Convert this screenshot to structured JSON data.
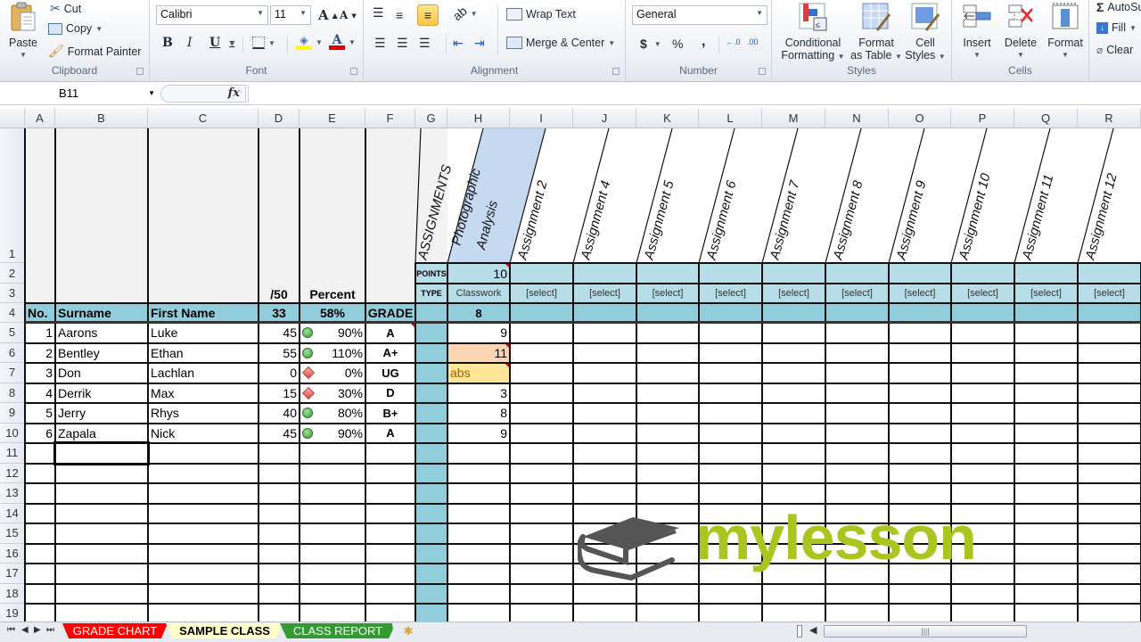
{
  "ribbon": {
    "clipboard": {
      "label": "Clipboard",
      "paste": "Paste",
      "cut": "Cut",
      "copy": "Copy",
      "format_painter": "Format Painter"
    },
    "font": {
      "label": "Font",
      "font_name": "Calibri",
      "font_size": "11",
      "bold": "B",
      "italic": "I",
      "underline": "U",
      "grow": "A",
      "shrink": "A",
      "highlight_color": "#ffff00",
      "font_color": "#e00000"
    },
    "alignment": {
      "label": "Alignment",
      "wrap_text": "Wrap Text",
      "merge_center": "Merge & Center"
    },
    "number": {
      "label": "Number",
      "format": "General",
      "currency": "$",
      "percent": "%",
      "comma": ",",
      "inc_decimal": "←.0 .00",
      "dec_decimal": ".00 →.0"
    },
    "styles": {
      "label": "Styles",
      "conditional_formatting": [
        "Conditional",
        "Formatting"
      ],
      "format_as_table": [
        "Format",
        "as Table"
      ],
      "cell_styles": [
        "Cell",
        "Styles"
      ]
    },
    "cells": {
      "label": "Cells",
      "insert": "Insert",
      "delete": "Delete",
      "format": "Format"
    },
    "editing": {
      "autosum": "AutoSum",
      "fill": "Fill",
      "clear": "Clear"
    }
  },
  "formula_bar": {
    "name_box": "B11",
    "fx": "fx",
    "formula": ""
  },
  "columns": [
    "A",
    "B",
    "C",
    "D",
    "E",
    "F",
    "G",
    "H",
    "I",
    "J",
    "K",
    "L",
    "M",
    "N",
    "O",
    "P",
    "Q",
    "R"
  ],
  "rows": [
    "1",
    "2",
    "3",
    "4",
    "5",
    "6",
    "7",
    "8",
    "9",
    "10",
    "11",
    "12",
    "13",
    "14",
    "15",
    "16",
    "17",
    "18",
    "19"
  ],
  "sheet": {
    "assignments_header": "ASSIGNMENTS",
    "assignments": [
      {
        "name": [
          "Photographic",
          "Analysis"
        ],
        "points": "10",
        "type": "Classwork",
        "average": "8"
      },
      {
        "name": [
          "Assignment 2"
        ],
        "points": "",
        "type": "[select]",
        "average": ""
      },
      {
        "name": [
          "Assignment 4"
        ],
        "points": "",
        "type": "[select]",
        "average": ""
      },
      {
        "name": [
          "Assignment 5"
        ],
        "points": "",
        "type": "[select]",
        "average": ""
      },
      {
        "name": [
          "Assignment 6"
        ],
        "points": "",
        "type": "[select]",
        "average": ""
      },
      {
        "name": [
          "Assignment 7"
        ],
        "points": "",
        "type": "[select]",
        "average": ""
      },
      {
        "name": [
          "Assignment 8"
        ],
        "points": "",
        "type": "[select]",
        "average": ""
      },
      {
        "name": [
          "Assignment 9"
        ],
        "points": "",
        "type": "[select]",
        "average": ""
      },
      {
        "name": [
          "Assignment 10"
        ],
        "points": "",
        "type": "[select]",
        "average": ""
      },
      {
        "name": [
          "Assignment 11"
        ],
        "points": "",
        "type": "[select]",
        "average": ""
      },
      {
        "name": [
          "Assignment 12"
        ],
        "points": "",
        "type": "[select]",
        "average": ""
      }
    ],
    "points_label": "POINTS",
    "type_label": "TYPE",
    "total_label": "/50",
    "percent_label": "Percent",
    "headers": {
      "no": "No.",
      "surname": "Surname",
      "first_name": "First Name",
      "total_avg": "33",
      "percent_avg": "58%",
      "grade": "GRADE"
    },
    "students": [
      {
        "no": "1",
        "surname": "Aarons",
        "first": "Luke",
        "total": "45",
        "indicator": "green-circle",
        "percent": "90%",
        "grade": "A",
        "h": "9",
        "h_style": ""
      },
      {
        "no": "2",
        "surname": "Bentley",
        "first": "Ethan",
        "total": "55",
        "indicator": "green-circle",
        "percent": "110%",
        "grade": "A+",
        "h": "11",
        "h_style": "over"
      },
      {
        "no": "3",
        "surname": "Don",
        "first": "Lachlan",
        "total": "0",
        "indicator": "red-diamond",
        "percent": "0%",
        "grade": "UG",
        "h": "abs",
        "h_style": "abs"
      },
      {
        "no": "4",
        "surname": "Derrik",
        "first": "Max",
        "total": "15",
        "indicator": "red-diamond",
        "percent": "30%",
        "grade": "D",
        "h": "3",
        "h_style": ""
      },
      {
        "no": "5",
        "surname": "Jerry",
        "first": "Rhys",
        "total": "40",
        "indicator": "green-circle",
        "percent": "80%",
        "grade": "B+",
        "h": "8",
        "h_style": ""
      },
      {
        "no": "6",
        "surname": "Zapala",
        "first": "Nick",
        "total": "45",
        "indicator": "green-circle",
        "percent": "90%",
        "grade": "A",
        "h": "9",
        "h_style": ""
      }
    ],
    "colors": {
      "header_band": "#92cddc",
      "assign_band": "#b7dee8",
      "selected_header": "#c5d9f1",
      "over_fill": "#fcd5b4",
      "abs_fill": "#ffe699",
      "abs_text": "#9c6500"
    }
  },
  "tabs": [
    {
      "label": "GRADE CHART",
      "color": "#ff0000",
      "active": false
    },
    {
      "label": "SAMPLE CLASS",
      "color": "#ffffcc",
      "active": true
    },
    {
      "label": "CLASS REPORT",
      "color": "#339933",
      "active": false
    }
  ],
  "logo": {
    "text": "mylesson",
    "color": "#a8c520"
  }
}
